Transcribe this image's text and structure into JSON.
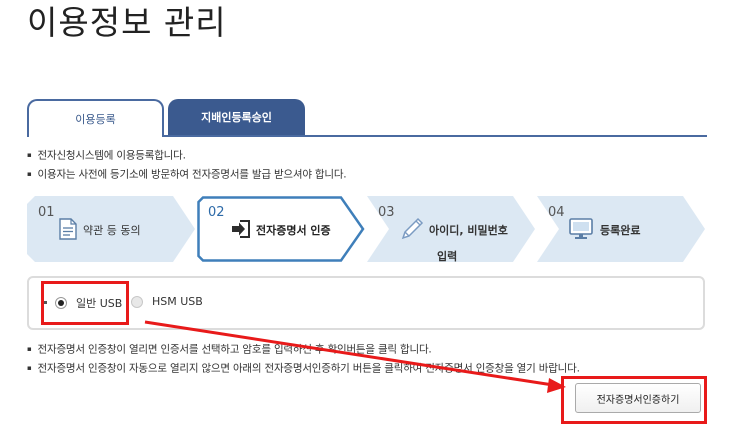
{
  "page": {
    "title": "이용정보 관리"
  },
  "tabs": [
    {
      "label": "이용등록",
      "active": true
    },
    {
      "label": "지배인등록승인",
      "active": false
    }
  ],
  "intro_lines": [
    "전자신청시스템에 이용등록합니다.",
    "이용자는 사전에 등기소에 방문하여 전자증명서를 발급 받으셔야 합니다."
  ],
  "steps": [
    {
      "num": "01",
      "label": "약관 등 동의",
      "icon": "document-icon"
    },
    {
      "num": "02",
      "label": "전자증명서 인증",
      "icon": "login-arrow-icon",
      "active": true
    },
    {
      "num": "03",
      "label": "아이디, 비밀번호",
      "label2": "입력",
      "icon": "pencil-icon"
    },
    {
      "num": "04",
      "label": "등록완료",
      "icon": "monitor-icon"
    }
  ],
  "usb_options": [
    {
      "label": "일반 USB",
      "checked": true
    },
    {
      "label": "HSM USB",
      "checked": false
    }
  ],
  "guide_lines": [
    "전자증명서 인증창이 열리면 인증서를 선택하고 암호를 입력하신 후 확인버튼을 클릭 합니다.",
    "전자증명서 인증창이 자동으로 열리지 않으면 아래의 전자증명서인증하기 버튼을 클릭하여 전자증명서 인증창을 열기 바랍니다."
  ],
  "buttons": {
    "certify": "전자증명서인증하기"
  },
  "colors": {
    "tab_navy": "#3b5a8f",
    "step_bg": "#dce8f3",
    "step_active_border": "#3f7fba",
    "annotation_red": "#e81a1a"
  }
}
